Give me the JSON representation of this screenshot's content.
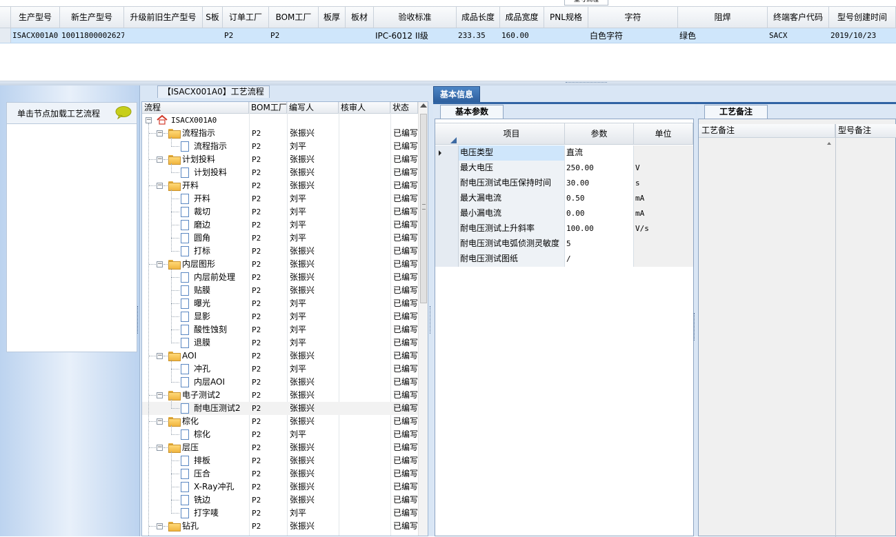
{
  "top_grid": {
    "tab_stub": "型号流程",
    "columns": [
      "生产型号",
      "新生产型号",
      "升级前旧生产型号",
      "S板",
      "订单工厂",
      "BOM工厂",
      "板厚",
      "板材",
      "验收标准",
      "成品长度",
      "成品宽度",
      "PNL规格",
      "字符",
      "阻焊",
      "终端客户代码",
      "型号创建时间"
    ],
    "row": [
      "ISACX001A0",
      "10011800002627",
      "",
      "",
      "P2",
      "P2",
      "",
      "",
      "IPC-6012 II级",
      "233.35",
      "160.00",
      "",
      "白色字符",
      "绿色",
      "SACX",
      "2019/10/23"
    ]
  },
  "left_panel": {
    "hint": "单击节点加载工艺流程"
  },
  "tree": {
    "title": "【ISACX001A0】工艺流程",
    "columns": [
      "流程",
      "BOM工厂",
      "编写人",
      "核审人",
      "状态"
    ],
    "rows": [
      {
        "label": "ISACX001A0",
        "level": 0,
        "kind": "root",
        "bom": "",
        "writer": "",
        "checker": "",
        "status": ""
      },
      {
        "label": "流程指示",
        "level": 1,
        "kind": "folder",
        "bom": "P2",
        "writer": "张振兴",
        "checker": "",
        "status": "已编写"
      },
      {
        "label": "流程指示",
        "level": 2,
        "kind": "doc",
        "bom": "P2",
        "writer": "刘平",
        "checker": "",
        "status": "已编写"
      },
      {
        "label": "计划投料",
        "level": 1,
        "kind": "folder",
        "bom": "P2",
        "writer": "张振兴",
        "checker": "",
        "status": "已编写"
      },
      {
        "label": "计划投料",
        "level": 2,
        "kind": "doc",
        "bom": "P2",
        "writer": "张振兴",
        "checker": "",
        "status": "已编写"
      },
      {
        "label": "开料",
        "level": 1,
        "kind": "folder",
        "bom": "P2",
        "writer": "张振兴",
        "checker": "",
        "status": "已编写"
      },
      {
        "label": "开料",
        "level": 2,
        "kind": "doc",
        "bom": "P2",
        "writer": "刘平",
        "checker": "",
        "status": "已编写"
      },
      {
        "label": "裁切",
        "level": 2,
        "kind": "doc",
        "bom": "P2",
        "writer": "刘平",
        "checker": "",
        "status": "已编写"
      },
      {
        "label": "磨边",
        "level": 2,
        "kind": "doc",
        "bom": "P2",
        "writer": "刘平",
        "checker": "",
        "status": "已编写"
      },
      {
        "label": "圆角",
        "level": 2,
        "kind": "doc",
        "bom": "P2",
        "writer": "刘平",
        "checker": "",
        "status": "已编写"
      },
      {
        "label": "打标",
        "level": 2,
        "kind": "doc",
        "bom": "P2",
        "writer": "张振兴",
        "checker": "",
        "status": "已编写"
      },
      {
        "label": "内层图形",
        "level": 1,
        "kind": "folder",
        "bom": "P2",
        "writer": "张振兴",
        "checker": "",
        "status": "已编写"
      },
      {
        "label": "内层前处理",
        "level": 2,
        "kind": "doc",
        "bom": "P2",
        "writer": "张振兴",
        "checker": "",
        "status": "已编写"
      },
      {
        "label": "贴膜",
        "level": 2,
        "kind": "doc",
        "bom": "P2",
        "writer": "张振兴",
        "checker": "",
        "status": "已编写"
      },
      {
        "label": "曝光",
        "level": 2,
        "kind": "doc",
        "bom": "P2",
        "writer": "刘平",
        "checker": "",
        "status": "已编写"
      },
      {
        "label": "显影",
        "level": 2,
        "kind": "doc",
        "bom": "P2",
        "writer": "刘平",
        "checker": "",
        "status": "已编写"
      },
      {
        "label": "酸性蚀刻",
        "level": 2,
        "kind": "doc",
        "bom": "P2",
        "writer": "刘平",
        "checker": "",
        "status": "已编写"
      },
      {
        "label": "退膜",
        "level": 2,
        "kind": "doc",
        "bom": "P2",
        "writer": "刘平",
        "checker": "",
        "status": "已编写"
      },
      {
        "label": "AOI",
        "level": 1,
        "kind": "folder",
        "bom": "P2",
        "writer": "张振兴",
        "checker": "",
        "status": "已编写"
      },
      {
        "label": "冲孔",
        "level": 2,
        "kind": "doc",
        "bom": "P2",
        "writer": "刘平",
        "checker": "",
        "status": "已编写"
      },
      {
        "label": "内层AOI",
        "level": 2,
        "kind": "doc",
        "bom": "P2",
        "writer": "张振兴",
        "checker": "",
        "status": "已编写"
      },
      {
        "label": "电子测试2",
        "level": 1,
        "kind": "folder",
        "bom": "P2",
        "writer": "张振兴",
        "checker": "",
        "status": "已编写"
      },
      {
        "label": "耐电压测试2",
        "level": 2,
        "kind": "doc",
        "bom": "P2",
        "writer": "张振兴",
        "checker": "",
        "status": "已编写",
        "selected": true
      },
      {
        "label": "棕化",
        "level": 1,
        "kind": "folder",
        "bom": "P2",
        "writer": "张振兴",
        "checker": "",
        "status": "已编写"
      },
      {
        "label": "棕化",
        "level": 2,
        "kind": "doc",
        "bom": "P2",
        "writer": "刘平",
        "checker": "",
        "status": "已编写"
      },
      {
        "label": "层压",
        "level": 1,
        "kind": "folder",
        "bom": "P2",
        "writer": "张振兴",
        "checker": "",
        "status": "已编写"
      },
      {
        "label": "排板",
        "level": 2,
        "kind": "doc",
        "bom": "P2",
        "writer": "张振兴",
        "checker": "",
        "status": "已编写"
      },
      {
        "label": "压合",
        "level": 2,
        "kind": "doc",
        "bom": "P2",
        "writer": "张振兴",
        "checker": "",
        "status": "已编写"
      },
      {
        "label": "X-Ray冲孔",
        "level": 2,
        "kind": "doc",
        "bom": "P2",
        "writer": "张振兴",
        "checker": "",
        "status": "已编写"
      },
      {
        "label": "铣边",
        "level": 2,
        "kind": "doc",
        "bom": "P2",
        "writer": "张振兴",
        "checker": "",
        "status": "已编写"
      },
      {
        "label": "打字唛",
        "level": 2,
        "kind": "doc",
        "bom": "P2",
        "writer": "刘平",
        "checker": "",
        "status": "已编写"
      },
      {
        "label": "钻孔",
        "level": 1,
        "kind": "folder",
        "bom": "P2",
        "writer": "张振兴",
        "checker": "",
        "status": "已编写"
      }
    ]
  },
  "info": {
    "tab": "基本信息",
    "params_tab": "基本参数",
    "columns": [
      "项目",
      "参数",
      "单位"
    ],
    "rows": [
      {
        "item": "电压类型",
        "value": "直流",
        "unit": ""
      },
      {
        "item": "最大电压",
        "value": "250.00",
        "unit": "V"
      },
      {
        "item": "耐电压测试电压保持时间",
        "value": "30.00",
        "unit": "s"
      },
      {
        "item": "最大漏电流",
        "value": "0.50",
        "unit": "mA"
      },
      {
        "item": "最小漏电流",
        "value": "0.00",
        "unit": "mA"
      },
      {
        "item": "耐电压测试上升斜率",
        "value": "100.00",
        "unit": "V/s"
      },
      {
        "item": "耐电压测试电弧侦测灵敏度",
        "value": "5",
        "unit": ""
      },
      {
        "item": "耐电压测试图纸",
        "value": "/",
        "unit": ""
      }
    ],
    "remarks_tab": "工艺备注",
    "remark_columns": [
      "工艺备注",
      "型号备注"
    ]
  },
  "colors": {
    "selected_row": "#cfe6fb",
    "tab_active": "#2d5f9e",
    "panel_bg": "#dbe7f5"
  }
}
